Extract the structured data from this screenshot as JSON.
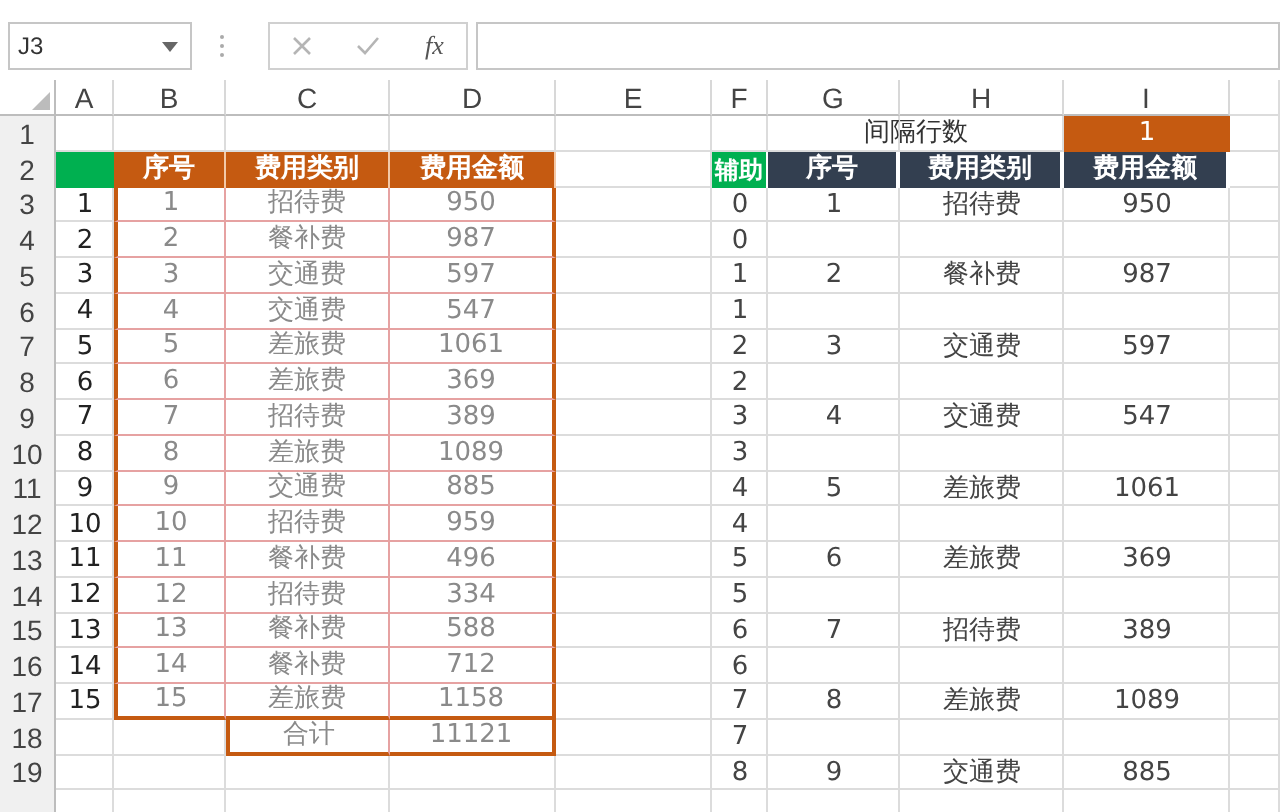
{
  "formula_bar": {
    "name_box": "J3",
    "function_button": "fx"
  },
  "columns": [
    "A",
    "B",
    "C",
    "D",
    "E",
    "F",
    "G",
    "H",
    "I"
  ],
  "row_numbers": [
    "1",
    "2",
    "3",
    "4",
    "5",
    "6",
    "7",
    "8",
    "9",
    "10",
    "11",
    "12",
    "13",
    "14",
    "15",
    "16",
    "17",
    "18",
    "19"
  ],
  "left_table": {
    "headers": [
      "序号",
      "费用类别",
      "费用金额"
    ],
    "rows": [
      {
        "index": "1",
        "no": "1",
        "category": "招待费",
        "amount": "950"
      },
      {
        "index": "2",
        "no": "2",
        "category": "餐补费",
        "amount": "987"
      },
      {
        "index": "3",
        "no": "3",
        "category": "交通费",
        "amount": "597"
      },
      {
        "index": "4",
        "no": "4",
        "category": "交通费",
        "amount": "547"
      },
      {
        "index": "5",
        "no": "5",
        "category": "差旅费",
        "amount": "1061"
      },
      {
        "index": "6",
        "no": "6",
        "category": "差旅费",
        "amount": "369"
      },
      {
        "index": "7",
        "no": "7",
        "category": "招待费",
        "amount": "389"
      },
      {
        "index": "8",
        "no": "8",
        "category": "差旅费",
        "amount": "1089"
      },
      {
        "index": "9",
        "no": "9",
        "category": "交通费",
        "amount": "885"
      },
      {
        "index": "10",
        "no": "10",
        "category": "招待费",
        "amount": "959"
      },
      {
        "index": "11",
        "no": "11",
        "category": "餐补费",
        "amount": "496"
      },
      {
        "index": "12",
        "no": "12",
        "category": "招待费",
        "amount": "334"
      },
      {
        "index": "13",
        "no": "13",
        "category": "餐补费",
        "amount": "588"
      },
      {
        "index": "14",
        "no": "14",
        "category": "餐补费",
        "amount": "712"
      },
      {
        "index": "15",
        "no": "15",
        "category": "差旅费",
        "amount": "1158"
      }
    ],
    "total": {
      "label": "合计",
      "value": "11121"
    }
  },
  "right_table": {
    "interval_label": "间隔行数",
    "interval_value": "1",
    "helper_header": "辅助",
    "headers": [
      "序号",
      "费用类别",
      "费用金额"
    ],
    "rows": [
      {
        "helper": "0",
        "no": "1",
        "category": "招待费",
        "amount": "950"
      },
      {
        "helper": "0"
      },
      {
        "helper": "1",
        "no": "2",
        "category": "餐补费",
        "amount": "987"
      },
      {
        "helper": "1"
      },
      {
        "helper": "2",
        "no": "3",
        "category": "交通费",
        "amount": "597"
      },
      {
        "helper": "2"
      },
      {
        "helper": "3",
        "no": "4",
        "category": "交通费",
        "amount": "547"
      },
      {
        "helper": "3"
      },
      {
        "helper": "4",
        "no": "5",
        "category": "差旅费",
        "amount": "1061"
      },
      {
        "helper": "4"
      },
      {
        "helper": "5",
        "no": "6",
        "category": "差旅费",
        "amount": "369"
      },
      {
        "helper": "5"
      },
      {
        "helper": "6",
        "no": "7",
        "category": "招待费",
        "amount": "389"
      },
      {
        "helper": "6"
      },
      {
        "helper": "7",
        "no": "8",
        "category": "差旅费",
        "amount": "1089"
      },
      {
        "helper": "7"
      },
      {
        "helper": "8",
        "no": "9",
        "category": "交通费",
        "amount": "885"
      }
    ]
  }
}
